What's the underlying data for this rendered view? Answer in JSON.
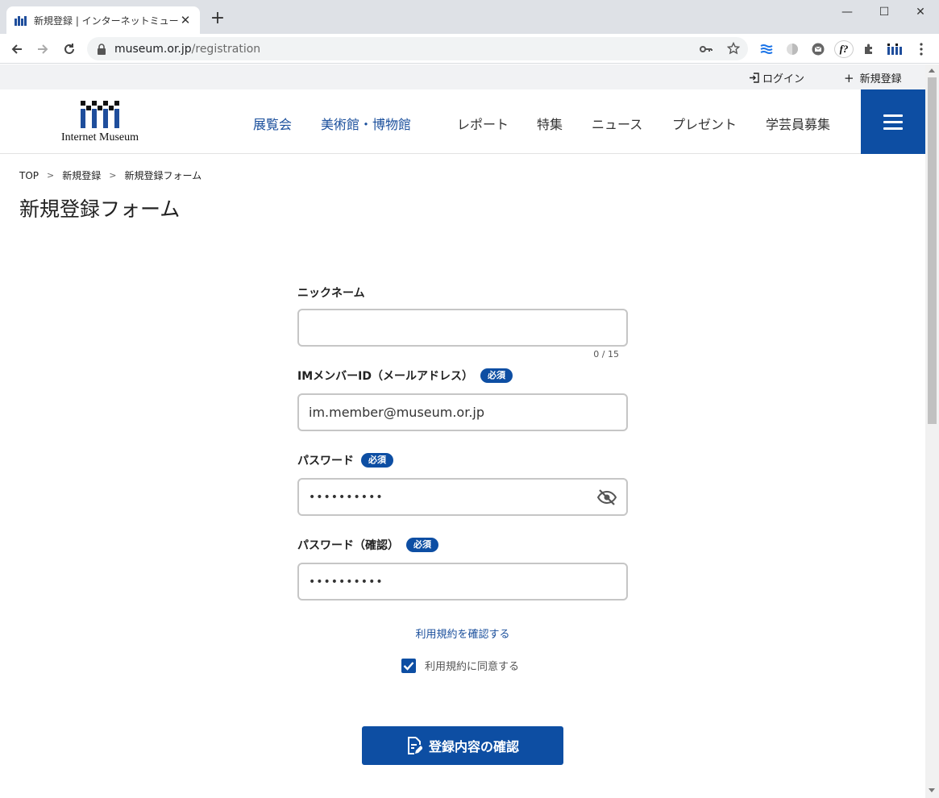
{
  "browser": {
    "tab_title": "新規登録 | インターネットミュージアム",
    "tab_close": "✕",
    "new_tab": "+",
    "url_host": "museum.or.jp",
    "url_path": "/registration",
    "window_controls": {
      "minimize": "—",
      "maximize": "☐",
      "close": "✕"
    },
    "extension_f_label": "f?"
  },
  "utility": {
    "login": "ログイン",
    "register": "新規登録",
    "register_prefix": "+"
  },
  "header": {
    "logo_text": "Internet Museum",
    "nav": [
      {
        "label": "展覧会"
      },
      {
        "label": "美術館・博物館"
      },
      {
        "label": "レポート"
      },
      {
        "label": "特集"
      },
      {
        "label": "ニュース"
      },
      {
        "label": "プレゼント"
      },
      {
        "label": "学芸員募集"
      }
    ],
    "accent_color": "#0d4ea3"
  },
  "breadcrumb": [
    "TOP",
    "新規登録",
    "新規登録フォーム"
  ],
  "breadcrumb_sep": ">",
  "page_title": "新規登録フォーム",
  "form": {
    "nickname": {
      "label": "ニックネーム",
      "value": "",
      "counter": "0 / 15"
    },
    "member_id": {
      "label": "IMメンバーID（メールアドレス）",
      "value": "im.member@museum.or.jp",
      "badge": "必須"
    },
    "password": {
      "label": "パスワード",
      "value": "••••••••••",
      "badge": "必須"
    },
    "password_confirm": {
      "label": "パスワード（確認）",
      "value": "••••••••••",
      "badge": "必須"
    },
    "terms_link": "利用規約を確認する",
    "agree_label": "利用規約に同意する",
    "agree_checked": true,
    "submit": "登録内容の確認"
  }
}
